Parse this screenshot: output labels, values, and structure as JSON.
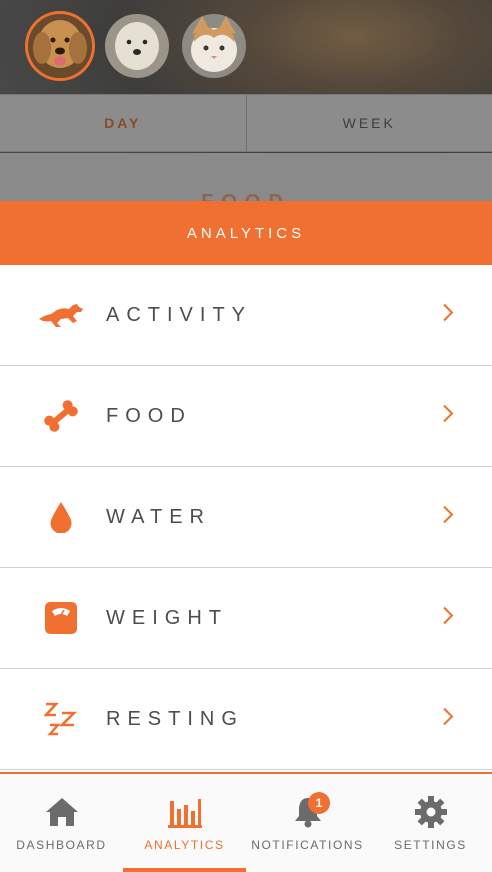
{
  "pets": [
    {
      "name": "golden-retriever",
      "selected": true
    },
    {
      "name": "white-dog",
      "selected": false
    },
    {
      "name": "tabby-cat",
      "selected": false
    }
  ],
  "period_tabs": [
    {
      "label": "DAY",
      "active": true
    },
    {
      "label": "WEEK",
      "active": false
    }
  ],
  "background_section_label": "FOOD",
  "analytics": {
    "title": "ANALYTICS",
    "items": [
      {
        "label": "ACTIVITY",
        "icon": "running-dog-icon"
      },
      {
        "label": "FOOD",
        "icon": "bone-icon"
      },
      {
        "label": "WATER",
        "icon": "water-drop-icon"
      },
      {
        "label": "WEIGHT",
        "icon": "scale-icon"
      },
      {
        "label": "RESTING",
        "icon": "zzz-icon"
      }
    ]
  },
  "tabbar": {
    "items": [
      {
        "label": "DASHBOARD",
        "icon": "home-icon",
        "active": false
      },
      {
        "label": "ANALYTICS",
        "icon": "bar-chart-icon",
        "active": true
      },
      {
        "label": "NOTIFICATIONS",
        "icon": "bell-icon",
        "active": false,
        "badge": "1"
      },
      {
        "label": "SETTINGS",
        "icon": "gear-icon",
        "active": false
      }
    ]
  },
  "colors": {
    "accent": "#ef7031",
    "text": "#4d4d4d",
    "divider": "#cfcfcf"
  }
}
